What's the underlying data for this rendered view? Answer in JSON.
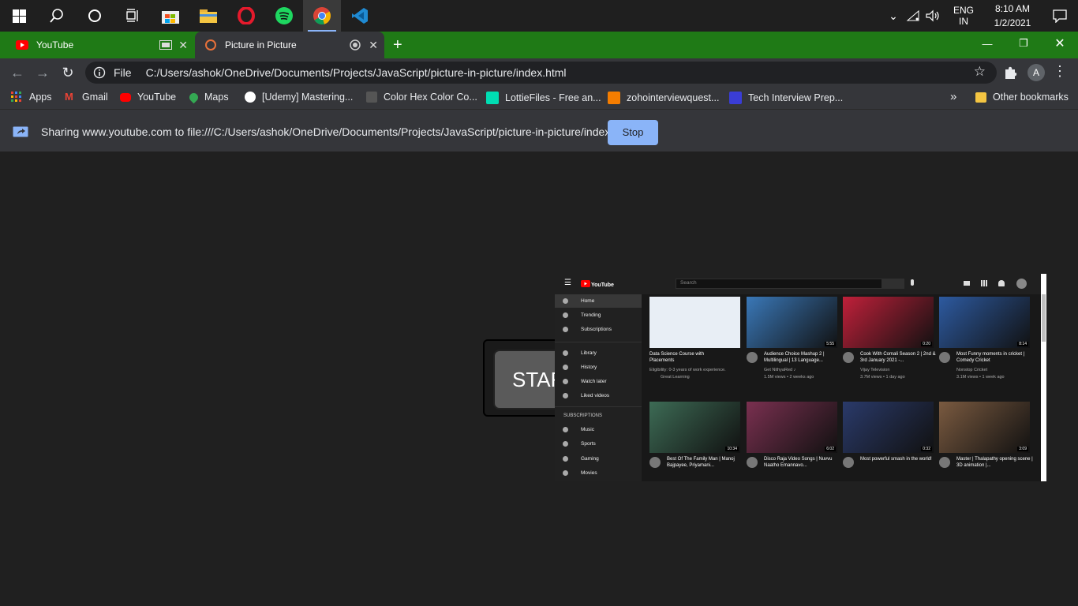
{
  "taskbar": {
    "time": "8:10 AM",
    "date": "1/2/2021",
    "lang1": "ENG",
    "lang2": "IN"
  },
  "tabs": [
    {
      "label": "YouTube"
    },
    {
      "label": "Picture in Picture"
    }
  ],
  "omnibox": {
    "scheme_label": "File",
    "url": "C:/Users/ashok/OneDrive/Documents/Projects/JavaScript/picture-in-picture/index.html",
    "profile_initial": "A"
  },
  "bookmarks": [
    {
      "label": "Apps",
      "color": "#4285f4"
    },
    {
      "label": "Gmail",
      "color": "#ea4335"
    },
    {
      "label": "YouTube",
      "color": "#ff0000"
    },
    {
      "label": "Maps",
      "color": "#34a853"
    },
    {
      "label": "[Udemy] Mastering...",
      "color": "#ffffff"
    },
    {
      "label": "Color Hex Color Co...",
      "color": "#555555"
    },
    {
      "label": "LottieFiles - Free an...",
      "color": "#00ddb3"
    },
    {
      "label": "zohointerviewquest...",
      "color": "#f57d00"
    },
    {
      "label": "Tech Interview Prep...",
      "color": "#3a3dd6"
    }
  ],
  "other_bookmarks": "Other bookmarks",
  "sharebar": {
    "text": "Sharing www.youtube.com to file:///C:/Users/ashok/OneDrive/Documents/Projects/JavaScript/picture-in-picture/index.html",
    "stop_label": "Stop"
  },
  "start_button": {
    "label": "STAR"
  },
  "pip": {
    "search_placeholder": "Search",
    "sidebar": [
      "Home",
      "Trending",
      "Subscriptions",
      "Library",
      "History",
      "Watch later",
      "Liked videos"
    ],
    "subs_heading": "SUBSCRIPTIONS",
    "subs": [
      "Music",
      "Sports",
      "Gaming",
      "Movies"
    ],
    "videos": [
      {
        "title": "Data Science Course with Placements",
        "channel": "Eligibility: 0-3 years of work experience.",
        "meta": "Great Learning",
        "duration": "",
        "color": "#e8eef5"
      },
      {
        "title": "Audience Choice Mashup 2 | Multilingual | 13 Language...",
        "channel": "Get NithyaRed ♪",
        "meta": "1.5M views • 2 weeks ago",
        "duration": "5:55",
        "color": "#3a78b8"
      },
      {
        "title": "Cook With Comali Season 2 | 2nd & 3rd January 2021 -...",
        "channel": "Vijay Television",
        "meta": "3.7M views • 1 day ago",
        "duration": "0:20",
        "color": "#c0203a"
      },
      {
        "title": "Most Funny moments in cricket | Comedy Cricket",
        "channel": "Nonstop Cricket",
        "meta": "3.1M views • 1 week ago",
        "duration": "8:14",
        "color": "#2d5aa0"
      },
      {
        "title": "Best Of The Family Man | Manoj Bajpayee, Priyamani...",
        "channel": "",
        "meta": "",
        "duration": "10:34",
        "color": "#3d6b55"
      },
      {
        "title": "Disco Raja Video Songs | Nuvvu Naatho Emannavo...",
        "channel": "",
        "meta": "",
        "duration": "6:02",
        "color": "#7a3050"
      },
      {
        "title": "Most powerful smash in the world!",
        "channel": "",
        "meta": "",
        "duration": "0:32",
        "color": "#2a3a6a"
      },
      {
        "title": "Master | Thalapathy opening scene | 3D animation |...",
        "channel": "",
        "meta": "",
        "duration": "3:09",
        "color": "#7a5a40"
      }
    ]
  }
}
